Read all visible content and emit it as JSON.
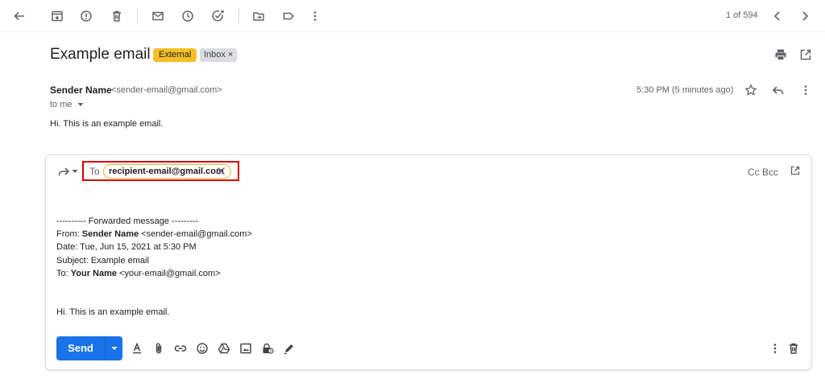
{
  "toolbar": {
    "icons": [
      "back-arrow-icon",
      "archive-icon",
      "report-spam-icon",
      "delete-icon",
      "mark-unread-icon",
      "snooze-icon",
      "add-task-icon",
      "move-to-icon",
      "label-icon",
      "more-icon"
    ],
    "pager_text": "1 of 594"
  },
  "message": {
    "subject": "Example email",
    "labels": {
      "external": "External",
      "inbox": "Inbox"
    },
    "sender_name": "Sender Name",
    "sender_email": "<sender-email@gmail.com>",
    "to_line": "to me",
    "time": "5:30 PM (5 minutes ago)",
    "body": "Hi. This is an example email."
  },
  "compose": {
    "to_label": "To",
    "recipient": "recipient-email@gmail.com",
    "cc_bcc": "Cc Bcc",
    "forward": {
      "separator": "---------- Forwarded message ---------",
      "from_label": "From: ",
      "from_name": "Sender Name",
      "from_email": " <sender-email@gmail.com>",
      "date": "Date: Tue, Jun 15, 2021 at 5:30 PM",
      "subject": "Subject: Example email",
      "to_label": "To: ",
      "to_name": "Your Name",
      "to_email": " <your-email@gmail.com>",
      "body": "Hi. This is an example email."
    },
    "send_label": "Send"
  },
  "colors": {
    "send_blue": "#1a73e8",
    "external_label": "#f6bf26",
    "highlight_red": "#d50000"
  }
}
